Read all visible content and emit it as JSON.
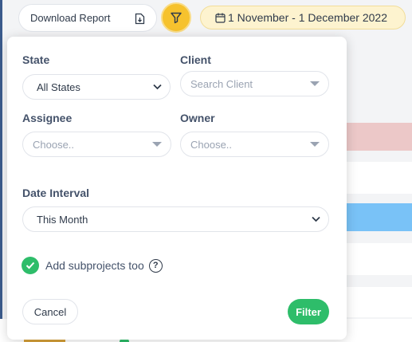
{
  "toolbar": {
    "download_label": "Download Report",
    "date_range": "1 November - 1 December 2022",
    "filter_button_color": "#f6c22e"
  },
  "filter_panel": {
    "state": {
      "label": "State",
      "value": "All States",
      "icon": "chevron-down-icon"
    },
    "client": {
      "label": "Client",
      "placeholder": "Search Client",
      "icon": "caret-down-icon"
    },
    "assignee": {
      "label": "Assignee",
      "placeholder": "Choose..",
      "icon": "caret-down-icon"
    },
    "owner": {
      "label": "Owner",
      "placeholder": "Choose..",
      "icon": "caret-down-icon"
    },
    "date_interval": {
      "label": "Date Interval",
      "value": "This Month",
      "icon": "chevron-down-icon"
    },
    "subprojects": {
      "label": "Add subprojects too",
      "checked": true,
      "help": "?"
    },
    "cancel_label": "Cancel",
    "apply_label": "Filter"
  },
  "colors": {
    "accent_green": "#2ebd6a",
    "accent_yellow": "#f6c22e",
    "date_chip_bg": "#fdf3cf",
    "row_pink": "#ecc8c8",
    "row_blue": "#79c2f7"
  }
}
